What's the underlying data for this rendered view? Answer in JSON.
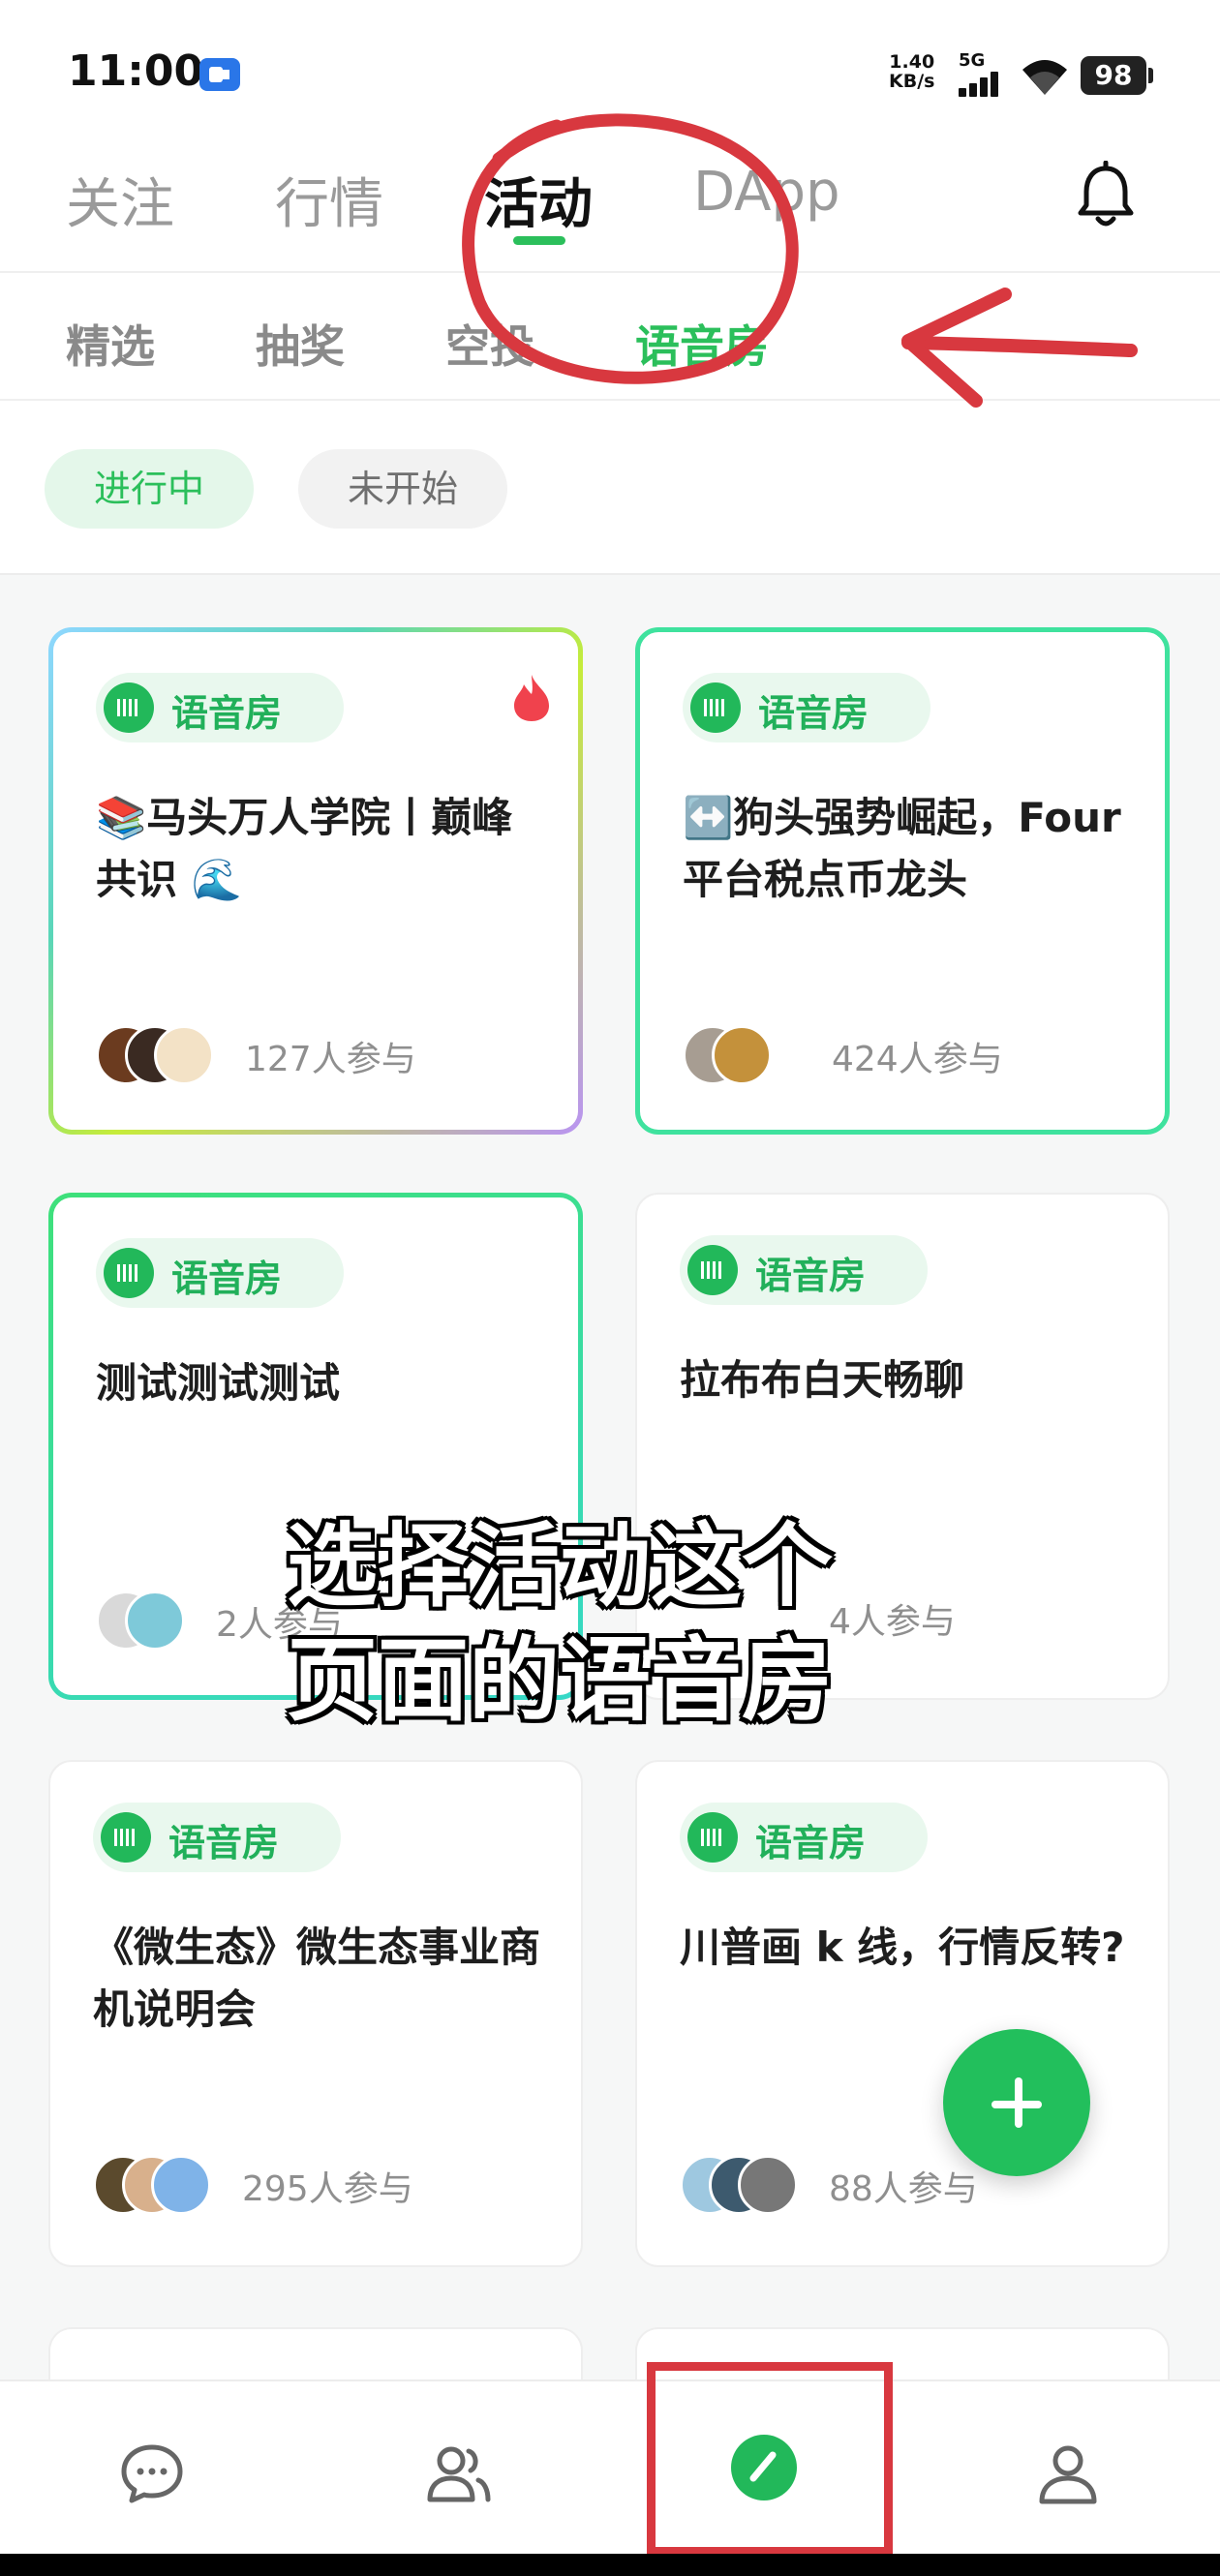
{
  "status_bar": {
    "time": "11:00",
    "net_speed_value": "1.40",
    "net_speed_unit": "KB/s",
    "network": "5G",
    "battery": "98"
  },
  "top_tabs": [
    "关注",
    "行情",
    "活动",
    "DApp"
  ],
  "top_tab_active": "活动",
  "sub_tabs": [
    "精选",
    "抽奖",
    "空投",
    "语音房"
  ],
  "sub_tab_active": "语音房",
  "filters": {
    "ongoing": "进行中",
    "not_started": "未开始",
    "selected": "进行中"
  },
  "badge_label": "语音房",
  "cards": [
    {
      "title": "📚马头万人学院丨巅峰共识 🌊",
      "participants": "127人参与",
      "hot": true,
      "style": "rainbow"
    },
    {
      "title": "↔️狗头强势崛起，Four平台税点币龙头",
      "participants": "424人参与",
      "style": "green"
    },
    {
      "title": "测试测试测试",
      "participants": "2人参与",
      "style": "cyangreen"
    },
    {
      "title": "拉布布白天畅聊",
      "participants": "4人参与",
      "style": "plain"
    },
    {
      "title": "《微生态》微生态事业商机说明会",
      "participants": "295人参与",
      "style": "plain"
    },
    {
      "title": "川普画 k 线，行情反转?",
      "participants": "88人参与",
      "style": "plain"
    }
  ],
  "caption_line1": "选择活动这个",
  "caption_line2": "页面的语音房",
  "bottom_nav": [
    "chat-icon",
    "contacts-icon",
    "activity-icon",
    "profile-icon"
  ],
  "colors": {
    "brand_green": "#2bbf5b",
    "annotation_red": "#d8383f"
  }
}
